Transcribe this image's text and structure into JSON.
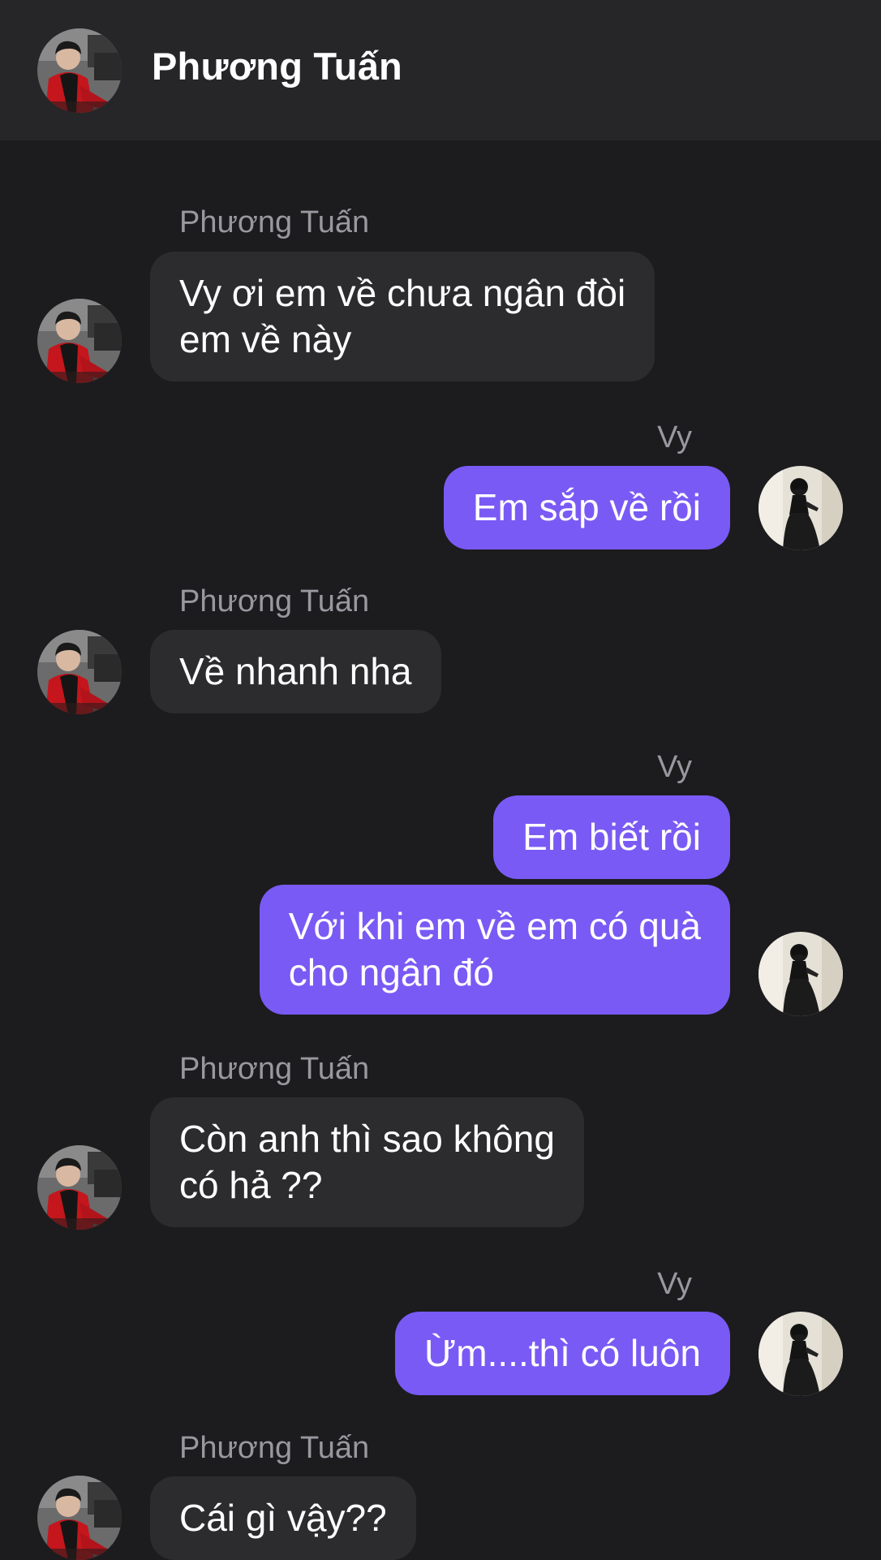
{
  "header": {
    "contact_name": "Phương Tuấn",
    "avatar": "contact-avatar"
  },
  "colors": {
    "background": "#1c1c1e",
    "header_background": "#262628",
    "incoming_bubble": "#2c2c2e",
    "outgoing_bubble": "#7a5af5",
    "sender_name": "#98989f",
    "text": "#ffffff"
  },
  "messages": [
    {
      "sender": "Phương Tuấn",
      "direction": "incoming",
      "text": "Vy ơi em về chưa ngân đòi\nem về này"
    },
    {
      "sender": "Vy",
      "direction": "outgoing",
      "text": "Em sắp về rồi"
    },
    {
      "sender": "Phương Tuấn",
      "direction": "incoming",
      "text": "Về nhanh nha"
    },
    {
      "sender": "Vy",
      "direction": "outgoing",
      "text": "Em biết rồi"
    },
    {
      "sender": "Vy",
      "direction": "outgoing",
      "text": "Với khi em về em có quà\ncho ngân đó"
    },
    {
      "sender": "Phương Tuấn",
      "direction": "incoming",
      "text": "Còn anh thì sao không\ncó hả ??"
    },
    {
      "sender": "Vy",
      "direction": "outgoing",
      "text": "Ừm....thì có luôn"
    },
    {
      "sender": "Phương Tuấn",
      "direction": "incoming",
      "text": "Cái gì vậy??"
    }
  ]
}
